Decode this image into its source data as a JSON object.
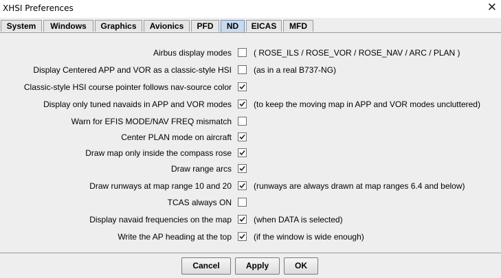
{
  "window": {
    "title": "XHSI Preferences",
    "close_icon": "close-icon"
  },
  "tabs": [
    {
      "label": "System",
      "selected": false
    },
    {
      "label": "Windows",
      "selected": false
    },
    {
      "label": "Graphics",
      "selected": false
    },
    {
      "label": "Avionics",
      "selected": false
    },
    {
      "label": "PFD",
      "selected": false
    },
    {
      "label": "ND",
      "selected": true
    },
    {
      "label": "EICAS",
      "selected": false
    },
    {
      "label": "MFD",
      "selected": false
    }
  ],
  "options": [
    {
      "label": "Airbus display modes",
      "checked": false,
      "note": "( ROSE_ILS / ROSE_VOR / ROSE_NAV / ARC / PLAN )"
    },
    {
      "label": "Display Centered APP and VOR as a classic-style HSI",
      "checked": false,
      "note": "(as in a real B737-NG)"
    },
    {
      "label": "Classic-style HSI course pointer follows nav-source color",
      "checked": true,
      "note": ""
    },
    {
      "label": "Display only tuned navaids in APP and VOR modes",
      "checked": true,
      "note": "(to keep the moving map in APP and VOR modes uncluttered)"
    },
    {
      "label": "Warn for EFIS MODE/NAV FREQ mismatch",
      "checked": false,
      "note": ""
    },
    {
      "label": "Center PLAN mode on aircraft",
      "checked": true,
      "note": ""
    },
    {
      "label": "Draw map only inside the compass rose",
      "checked": true,
      "note": ""
    },
    {
      "label": "Draw range arcs",
      "checked": true,
      "note": ""
    },
    {
      "label": "Draw runways at map range 10 and 20",
      "checked": true,
      "note": "(runways are always drawn at map ranges 6.4 and below)"
    },
    {
      "label": "TCAS always ON",
      "checked": false,
      "note": ""
    },
    {
      "label": "Display navaid frequencies on the map",
      "checked": true,
      "note": "(when DATA is selected)"
    },
    {
      "label": "Write the AP heading at the top",
      "checked": true,
      "note": "(if the window is wide enough)"
    }
  ],
  "buttons": {
    "cancel": "Cancel",
    "apply": "Apply",
    "ok": "OK"
  }
}
